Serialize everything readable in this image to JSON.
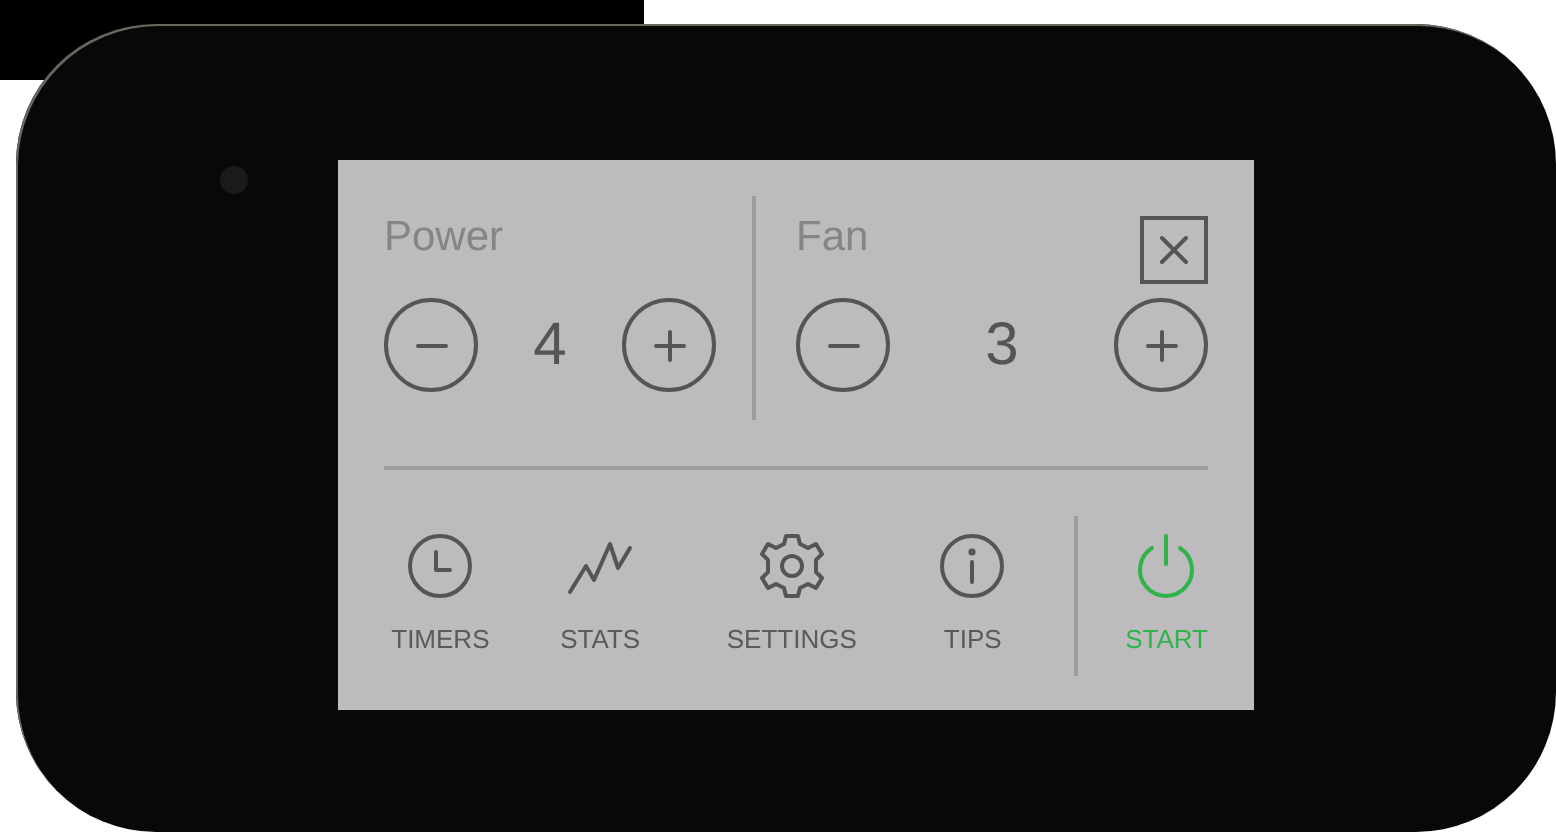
{
  "controls": [
    {
      "label": "Power",
      "value": "4"
    },
    {
      "label": "Fan",
      "value": "3"
    }
  ],
  "nav": [
    {
      "label": "TIMERS",
      "kind": "timers"
    },
    {
      "label": "STATS",
      "kind": "stats"
    },
    {
      "label": "SETTINGS",
      "kind": "settings"
    },
    {
      "label": "TIPS",
      "kind": "tips"
    },
    {
      "label": "START",
      "kind": "start"
    }
  ]
}
